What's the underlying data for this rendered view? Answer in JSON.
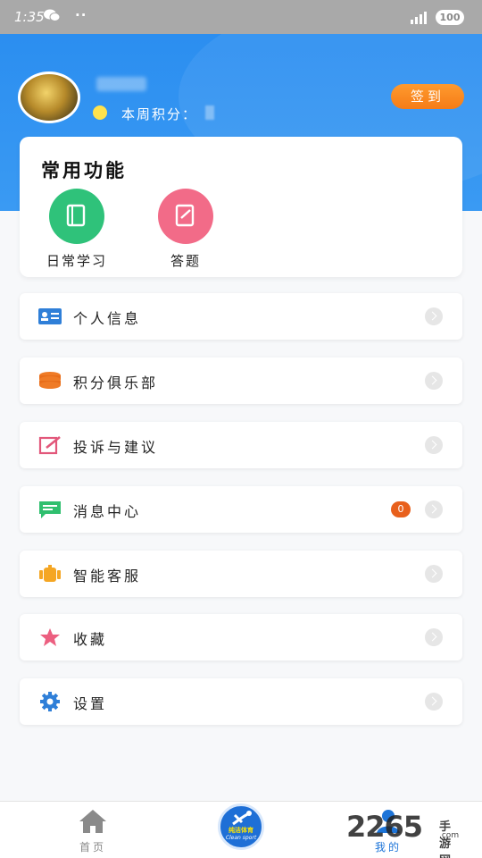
{
  "status_bar": {
    "time": "1:35",
    "dots": "··",
    "battery": "100"
  },
  "header": {
    "points_label": "本周积分：",
    "signin_label": "签到"
  },
  "common_functions": {
    "title": "常用功能",
    "items": [
      {
        "label": "日常学习",
        "icon": "book-icon",
        "color": "#2fc27a"
      },
      {
        "label": "答题",
        "icon": "edit-note-icon",
        "color": "#f26b88"
      }
    ]
  },
  "menu": [
    {
      "label": "个人信息",
      "icon": "id-card-icon"
    },
    {
      "label": "积分俱乐部",
      "icon": "coins-icon"
    },
    {
      "label": "投诉与建议",
      "icon": "feedback-edit-icon"
    },
    {
      "label": "消息中心",
      "icon": "message-icon",
      "badge": "0"
    },
    {
      "label": "智能客服",
      "icon": "robot-icon"
    },
    {
      "label": "收藏",
      "icon": "star-icon"
    },
    {
      "label": "设置",
      "icon": "gear-icon"
    }
  ],
  "bottom_nav": {
    "home": "首页",
    "center_brand_cn": "纯洁体育",
    "center_brand_en": "Clean sport",
    "mine": "我的"
  },
  "watermark": {
    "main": "2265",
    "sub1": "手游网",
    "sub2": ".com"
  },
  "colors": {
    "primary_blue": "#2b8ef0",
    "signin_orange": "#f57c17",
    "badge_orange": "#e8601c"
  }
}
